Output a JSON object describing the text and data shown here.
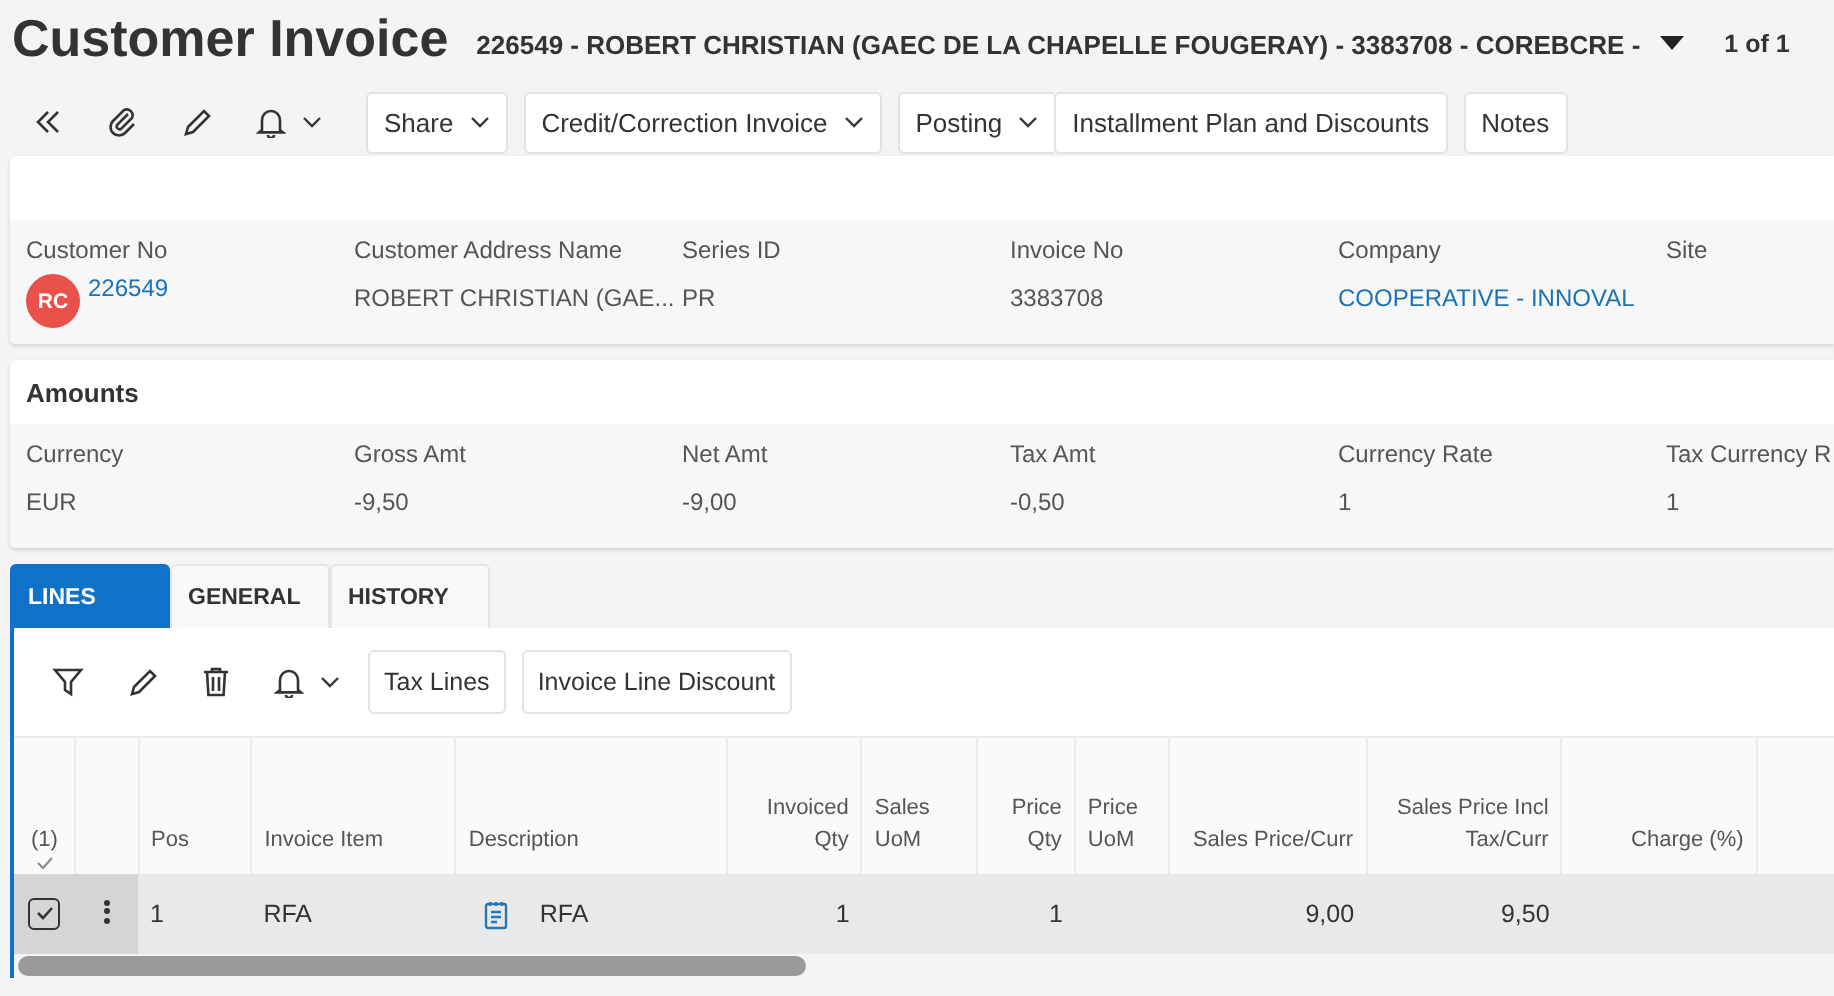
{
  "header": {
    "title": "Customer Invoice",
    "record": "226549 - ROBERT CHRISTIAN (GAEC DE LA CHAPELLE FOUGERAY) - 3383708 - COREBCRE -",
    "pager": "1 of 1"
  },
  "toolbar": {
    "buttons": [
      {
        "label": "Share",
        "caret": true
      },
      {
        "label": "Credit/Correction Invoice",
        "caret": true
      },
      {
        "label": "Posting",
        "caret": true
      },
      {
        "label": "Installment Plan and Discounts",
        "caret": false
      },
      {
        "label": "Notes",
        "caret": false
      }
    ]
  },
  "customer_card": {
    "fields": [
      {
        "label": "Customer No",
        "value": "226549",
        "kind": "avatar-link",
        "avatar": "RC",
        "color": "#e8524a"
      },
      {
        "label": "Customer Address Name",
        "value": "ROBERT CHRISTIAN (GAE...",
        "kind": "text"
      },
      {
        "label": "Series ID",
        "value": "PR",
        "kind": "text"
      },
      {
        "label": "Invoice No",
        "value": "3383708",
        "kind": "text"
      },
      {
        "label": "Company",
        "value": "COOPERATIVE - INNOVAL",
        "kind": "link"
      },
      {
        "label": "Site"
      }
    ]
  },
  "amounts_card": {
    "title": "Amounts",
    "fields": [
      {
        "label": "Currency",
        "value": "EUR",
        "kind": "text"
      },
      {
        "label": "Gross Amt",
        "value": "-9,50",
        "kind": "text"
      },
      {
        "label": "Net Amt",
        "value": "-9,00",
        "kind": "text"
      },
      {
        "label": "Tax Amt",
        "value": "-0,50",
        "kind": "text"
      },
      {
        "label": "Currency Rate",
        "value": "1",
        "kind": "text"
      },
      {
        "label": "Tax Currency R",
        "value": "1",
        "kind": "text"
      }
    ]
  },
  "tabs": [
    {
      "label": "LINES",
      "selected": true
    },
    {
      "label": "GENERAL",
      "selected": false
    },
    {
      "label": "HISTORY",
      "selected": false
    }
  ],
  "lines": {
    "buttons": [
      "Tax Lines",
      "Invoice Line Discount"
    ],
    "selection_count": "(1)",
    "columns": [
      {
        "label": "Pos",
        "kind": "text"
      },
      {
        "label": "Invoice Item",
        "kind": "text"
      },
      {
        "label": "Description",
        "kind": "note"
      },
      {
        "label": "Invoiced Qty",
        "kind": "number"
      },
      {
        "label": "Sales UoM",
        "kind": "text"
      },
      {
        "label": "Price Qty",
        "kind": "number"
      },
      {
        "label": "Price UoM",
        "kind": "text"
      },
      {
        "label": "Sales Price/Curr",
        "kind": "number"
      },
      {
        "label": "Sales Price Incl Tax/Curr",
        "kind": "number"
      },
      {
        "label": "Charge (%)",
        "kind": "number"
      }
    ],
    "rows": [
      {
        "selected": true,
        "cells": [
          "1",
          "RFA",
          "RFA",
          "1",
          null,
          "1",
          null,
          "9,00",
          "9,50",
          null
        ]
      }
    ]
  }
}
